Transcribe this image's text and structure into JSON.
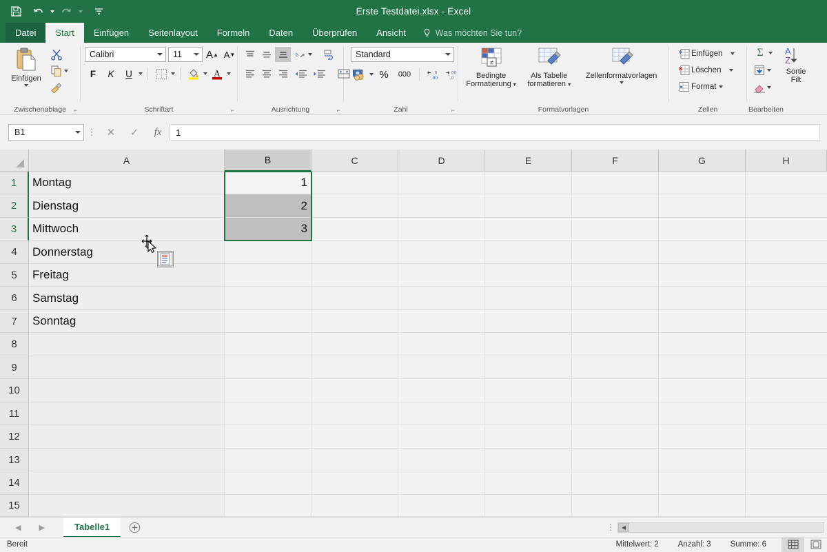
{
  "window": {
    "title": "Erste Testdatei.xlsx - Excel",
    "quick_access": [
      {
        "name": "save-icon",
        "label": "Speichern"
      },
      {
        "name": "undo-icon",
        "label": "Rückgängig"
      },
      {
        "name": "redo-icon",
        "label": "Wiederholen"
      },
      {
        "name": "customize-qat-icon",
        "label": "Symbolleiste für den Schnellzugriff anpassen"
      }
    ]
  },
  "ribbon": {
    "tabs": [
      {
        "label": "Datei",
        "active": false
      },
      {
        "label": "Start",
        "active": true
      },
      {
        "label": "Einfügen",
        "active": false
      },
      {
        "label": "Seitenlayout",
        "active": false
      },
      {
        "label": "Formeln",
        "active": false
      },
      {
        "label": "Daten",
        "active": false
      },
      {
        "label": "Überprüfen",
        "active": false
      },
      {
        "label": "Ansicht",
        "active": false
      }
    ],
    "tell_me": "Was möchten Sie tun?",
    "groups": {
      "clipboard": {
        "caption": "Zwischenablage",
        "paste_label": "Einfügen",
        "buttons": [
          "Ausschneiden",
          "Kopieren",
          "Format übertragen"
        ]
      },
      "font": {
        "caption": "Schriftart",
        "font_family": "Calibri",
        "font_size": "11",
        "bold": "F",
        "italic": "K",
        "underline": "U",
        "grow_label": "A",
        "shrink_label": "A"
      },
      "alignment": {
        "caption": "Ausrichtung",
        "buttons": [
          "Oben ausrichten",
          "Vertikal zentrieren",
          "Unten ausrichten",
          "Ausrichtung",
          "Einzug verkleinern",
          "Einzug vergrößern",
          "Linksbündig",
          "Zentriert",
          "Rechtsbündig",
          "Zeilenumbruch",
          "Verbinden und zentrieren"
        ]
      },
      "number": {
        "caption": "Zahl",
        "format": "Standard",
        "percent": "%",
        "thousands": "000"
      },
      "styles": {
        "caption": "Formatvorlagen",
        "conditional_line1": "Bedingte",
        "conditional_line2": "Formatierung",
        "table_line1": "Als Tabelle",
        "table_line2": "formatieren",
        "cellstyles": "Zellenformatvorlagen"
      },
      "cells": {
        "caption": "Zellen",
        "insert": "Einfügen",
        "delete": "Löschen",
        "format": "Format"
      },
      "editing": {
        "caption": "Bearbeiten",
        "sort_line1": "Sortie",
        "sort_line2": "Filt",
        "autosum": "Σ"
      }
    }
  },
  "formula_bar": {
    "name_box": "B1",
    "value": "1",
    "cancel_icon": "✕",
    "accept_icon": "✓",
    "function_icon": "fx"
  },
  "grid": {
    "columns": [
      "A",
      "B",
      "C",
      "D",
      "E",
      "F",
      "G",
      "H"
    ],
    "selected_column": "B",
    "rows": [
      "1",
      "2",
      "3",
      "4",
      "5",
      "6",
      "7",
      "8",
      "9",
      "10",
      "11",
      "12",
      "13",
      "14",
      "15"
    ],
    "selected_rows": [
      "1",
      "2",
      "3"
    ],
    "data": [
      {
        "row": "1",
        "A": "Montag",
        "B": "1"
      },
      {
        "row": "2",
        "A": "Dienstag",
        "B": "2"
      },
      {
        "row": "3",
        "A": "Mittwoch",
        "B": "3"
      },
      {
        "row": "4",
        "A": "Donnerstag",
        "B": ""
      },
      {
        "row": "5",
        "A": "Freitag",
        "B": ""
      },
      {
        "row": "6",
        "A": "Samstag",
        "B": ""
      },
      {
        "row": "7",
        "A": "Sonntag",
        "B": ""
      }
    ],
    "selection_range": "B1:B3",
    "active_cell": "B1",
    "cursor": "move-cursor",
    "paste_options_icon": "paste-options-icon"
  },
  "sheet_bar": {
    "prev_label": "◀",
    "next_label": "▶",
    "tabs": [
      {
        "label": "Tabelle1",
        "active": true
      }
    ],
    "add_label": "+"
  },
  "status_bar": {
    "mode": "Bereit",
    "average": "Mittelwert: 2",
    "count": "Anzahl: 3",
    "sum": "Summe: 6",
    "views": [
      {
        "name": "normal-view-icon",
        "active": true
      },
      {
        "name": "page-layout-view-icon",
        "active": false
      }
    ]
  },
  "colors": {
    "brand_green": "#217346",
    "selection_fill": "#bfbfbf",
    "header_gray": "#e6e6e6"
  }
}
